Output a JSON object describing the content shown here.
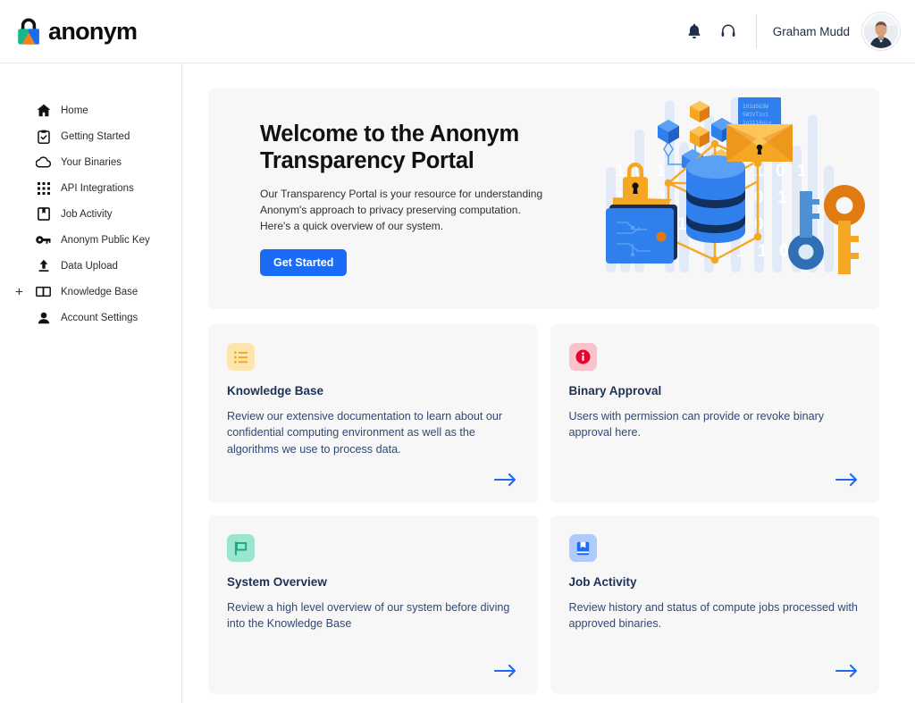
{
  "header": {
    "logo_icon": "anonym-padlock-logo",
    "logo_text": "anonym",
    "notifications_icon": "bell-icon",
    "support_icon": "headset-icon",
    "user_name": "Graham Mudd",
    "avatar_icon": "user-avatar-photo"
  },
  "sidebar": {
    "items": [
      {
        "label": "Home",
        "icon": "home-icon",
        "expander": ""
      },
      {
        "label": "Getting Started",
        "icon": "clipboard-check-icon",
        "expander": ""
      },
      {
        "label": "Your Binaries",
        "icon": "cloud-icon",
        "expander": ""
      },
      {
        "label": "API Integrations",
        "icon": "grid-dots-icon",
        "expander": ""
      },
      {
        "label": "Job Activity",
        "icon": "bookmark-book-icon",
        "expander": ""
      },
      {
        "label": "Anonym Public Key",
        "icon": "key-icon",
        "expander": ""
      },
      {
        "label": "Data Upload",
        "icon": "upload-icon",
        "expander": ""
      },
      {
        "label": "Knowledge Base",
        "icon": "open-book-icon",
        "expander": "+"
      },
      {
        "label": "Account Settings",
        "icon": "person-icon",
        "expander": ""
      }
    ]
  },
  "hero": {
    "title": "Welcome to the Anonym Transparency Portal",
    "subtitle": "Our Transparency Portal is your resource for understanding Anonym's approach to privacy preserving computation. Here's a quick overview of our system.",
    "cta_label": "Get Started",
    "illustration_icon": "privacy-computation-illustration"
  },
  "cards": [
    {
      "title": "Knowledge Base",
      "description": "Review our extensive documentation to learn about our confidential computing environment as well as the algorithms we use to process data.",
      "badge_icon": "list-icon",
      "badge_bg": "#FDE5B0",
      "badge_fg": "#F5A623",
      "arrow_icon": "arrow-right-icon"
    },
    {
      "title": "Binary Approval",
      "description": "Users with permission can provide or revoke binary approval here.",
      "badge_icon": "info-circle-icon",
      "badge_bg": "#FBC2CC",
      "badge_fg": "#E8002E",
      "arrow_icon": "arrow-right-icon"
    },
    {
      "title": "System Overview",
      "description": "Review a high level overview of our system before diving into the Knowledge Base",
      "badge_icon": "flag-icon",
      "badge_bg": "#9BE6CF",
      "badge_fg": "#16A97E",
      "arrow_icon": "arrow-right-icon"
    },
    {
      "title": "Job Activity",
      "description": "Review history and status of compute jobs processed with approved binaries.",
      "badge_icon": "bookmark-book-icon",
      "badge_bg": "#AFCBFB",
      "badge_fg": "#1A6BF5",
      "arrow_icon": "arrow-right-icon"
    }
  ],
  "colors": {
    "accent_blue": "#1A6BF5",
    "panel_bg": "#F7F7F8",
    "text_navy": "#1D3156",
    "body_navy": "#2E4976"
  }
}
